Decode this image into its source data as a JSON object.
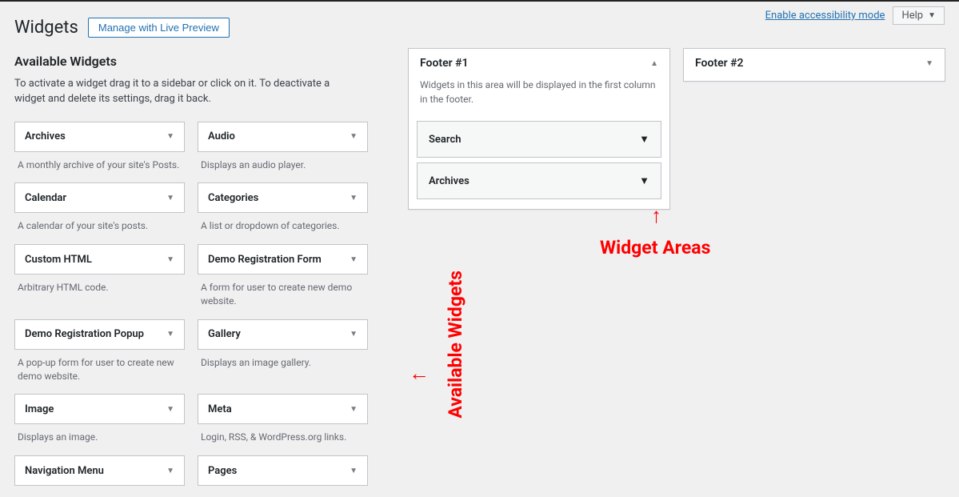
{
  "topbar": {
    "accessibility_link": "Enable accessibility mode",
    "help_label": "Help"
  },
  "page": {
    "title": "Widgets",
    "preview_button": "Manage with Live Preview"
  },
  "available": {
    "heading": "Available Widgets",
    "help_text": "To activate a widget drag it to a sidebar or click on it. To deactivate a widget and delete its settings, drag it back.",
    "widgets": [
      {
        "name": "Archives",
        "desc": "A monthly archive of your site's Posts."
      },
      {
        "name": "Audio",
        "desc": "Displays an audio player."
      },
      {
        "name": "Calendar",
        "desc": "A calendar of your site's posts."
      },
      {
        "name": "Categories",
        "desc": "A list or dropdown of categories."
      },
      {
        "name": "Custom HTML",
        "desc": "Arbitrary HTML code."
      },
      {
        "name": "Demo Registration Form",
        "desc": "A form for user to create new demo website."
      },
      {
        "name": "Demo Registration Popup",
        "desc": "A pop-up form for user to create new demo website."
      },
      {
        "name": "Gallery",
        "desc": "Displays an image gallery."
      },
      {
        "name": "Image",
        "desc": "Displays an image."
      },
      {
        "name": "Meta",
        "desc": "Login, RSS, & WordPress.org links."
      },
      {
        "name": "Navigation Menu",
        "desc": ""
      },
      {
        "name": "Pages",
        "desc": ""
      }
    ]
  },
  "areas": {
    "footer1": {
      "title": "Footer #1",
      "desc": "Widgets in this area will be displayed in the first column in the footer.",
      "items": [
        {
          "label": "Search"
        },
        {
          "label": "Archives"
        }
      ]
    },
    "footer2": {
      "title": "Footer #2"
    }
  },
  "annotations": {
    "widget_areas": "Widget Areas",
    "available_widgets": "Available Widgets"
  }
}
